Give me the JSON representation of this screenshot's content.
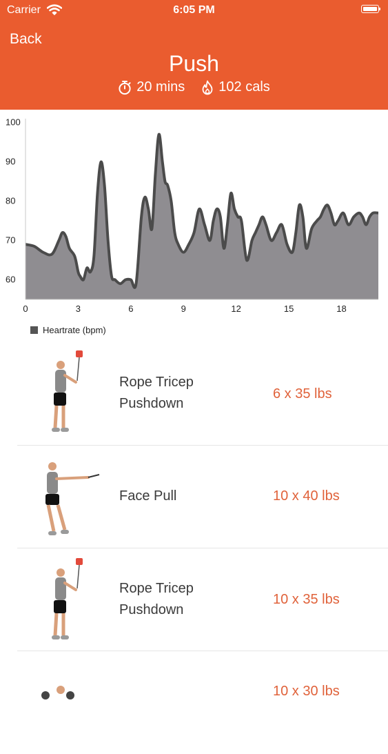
{
  "status_bar": {
    "carrier": "Carrier",
    "time": "6:05 PM"
  },
  "header": {
    "back_label": "Back",
    "title": "Push",
    "duration": "20 mins",
    "calories": "102 cals",
    "duration_icon": "stopwatch-icon",
    "calories_icon": "flame-icon",
    "background_color": "#ea5c2f"
  },
  "chart_data": {
    "type": "area",
    "legend": [
      "Heartrate (bpm)"
    ],
    "legend_position": "bottom-left",
    "x_ticks": [
      "0",
      "3",
      "6",
      "9",
      "12",
      "15",
      "18"
    ],
    "y_ticks": [
      "100",
      "90",
      "80",
      "70",
      "60"
    ],
    "xlim": [
      0,
      20.1
    ],
    "ylim": [
      55,
      101
    ],
    "grid": false,
    "series": [
      {
        "name": "Heartrate (bpm)",
        "x": [
          0,
          0.5,
          1,
          1.5,
          1.9,
          2.1,
          2.3,
          2.5,
          2.8,
          3.0,
          3.1,
          3.3,
          3.5,
          3.7,
          3.9,
          4.1,
          4.3,
          4.5,
          4.7,
          4.9,
          5.1,
          5.4,
          5.7,
          6.0,
          6.3,
          6.6,
          6.8,
          7.0,
          7.2,
          7.4,
          7.6,
          7.8,
          7.95,
          8.1,
          8.3,
          8.5,
          8.7,
          9.0,
          9.3,
          9.6,
          9.9,
          10.2,
          10.5,
          10.7,
          10.9,
          11.1,
          11.3,
          11.5,
          11.7,
          11.9,
          12.1,
          12.3,
          12.6,
          12.9,
          13.1,
          13.3,
          13.5,
          13.7,
          14.0,
          14.3,
          14.6,
          14.9,
          15.2,
          15.4,
          15.6,
          15.8,
          16.0,
          16.3,
          16.6,
          16.8,
          17.0,
          17.2,
          17.4,
          17.6,
          17.8,
          18.1,
          18.4,
          18.7,
          19.0,
          19.2,
          19.4,
          19.6,
          19.8,
          20.1
        ],
        "values": [
          69,
          68.5,
          67,
          66.5,
          70,
          72,
          71,
          68,
          66,
          62,
          61,
          60,
          63,
          62,
          66,
          82,
          90,
          84,
          70,
          61,
          60,
          59,
          60,
          60,
          59,
          76,
          81,
          78,
          73,
          87,
          97,
          90,
          85,
          84,
          80,
          72,
          69,
          67,
          69,
          72,
          78,
          74,
          70,
          75,
          78,
          76,
          68,
          74,
          82,
          78,
          76,
          75,
          65,
          70,
          72,
          74,
          76,
          74,
          70,
          72,
          74,
          69,
          67,
          72,
          79,
          76,
          68,
          73,
          75,
          76,
          78,
          79,
          77,
          74,
          75,
          77,
          74,
          76,
          77,
          76,
          74,
          76,
          77,
          77
        ]
      }
    ]
  },
  "exercises": [
    {
      "name_line1": "Rope Tricep",
      "name_line2": "Pushdown",
      "detail": "6 x 35 lbs",
      "icon": "rope-pushdown-figure-icon"
    },
    {
      "name_line1": "Face Pull",
      "name_line2": "",
      "detail": "10 x 40 lbs",
      "icon": "face-pull-figure-icon"
    },
    {
      "name_line1": "Rope Tricep",
      "name_line2": "Pushdown",
      "detail": "10 x 35 lbs",
      "icon": "rope-pushdown-figure-icon"
    },
    {
      "name_line1": "",
      "name_line2": "",
      "detail": "10 x 30 lbs",
      "icon": "exercise-figure-icon"
    }
  ]
}
